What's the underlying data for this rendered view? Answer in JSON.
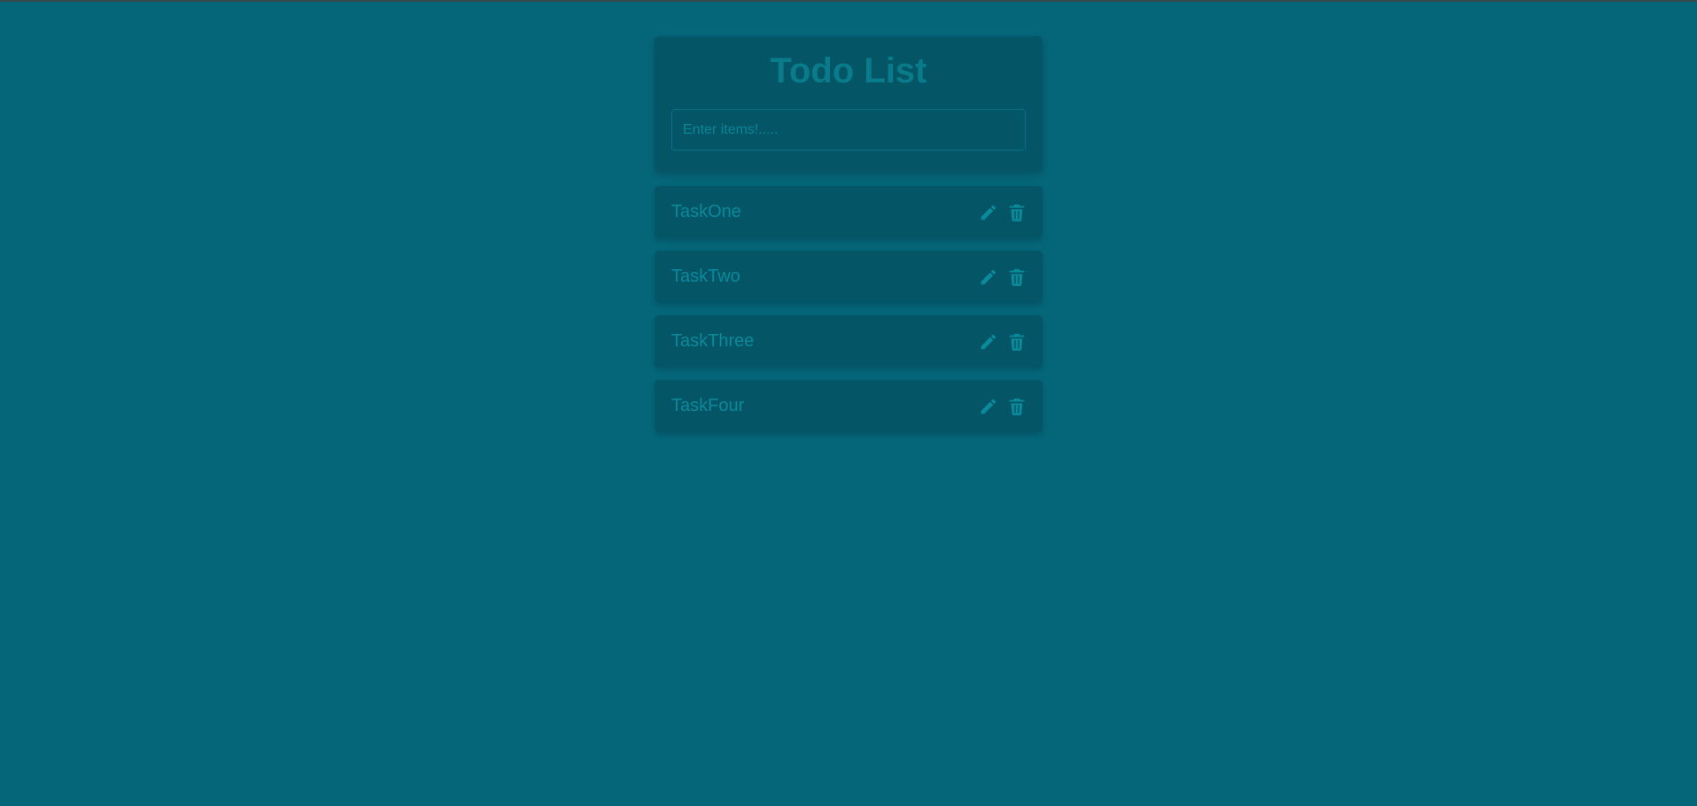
{
  "app": {
    "title": "Todo List",
    "input": {
      "placeholder": "Enter items!.....",
      "value": ""
    }
  },
  "tasks": [
    {
      "label": "TaskOne",
      "edit_icon": "pencil-icon",
      "delete_icon": "trash-icon"
    },
    {
      "label": "TaskTwo",
      "edit_icon": "pencil-icon",
      "delete_icon": "trash-icon"
    },
    {
      "label": "TaskThree",
      "edit_icon": "pencil-icon",
      "delete_icon": "trash-icon"
    },
    {
      "label": "TaskFour",
      "edit_icon": "pencil-icon",
      "delete_icon": "trash-icon"
    }
  ],
  "colors": {
    "background": "#056579",
    "card": "#045565",
    "text": "#0a8a9b",
    "title": "#0a7b8a"
  }
}
